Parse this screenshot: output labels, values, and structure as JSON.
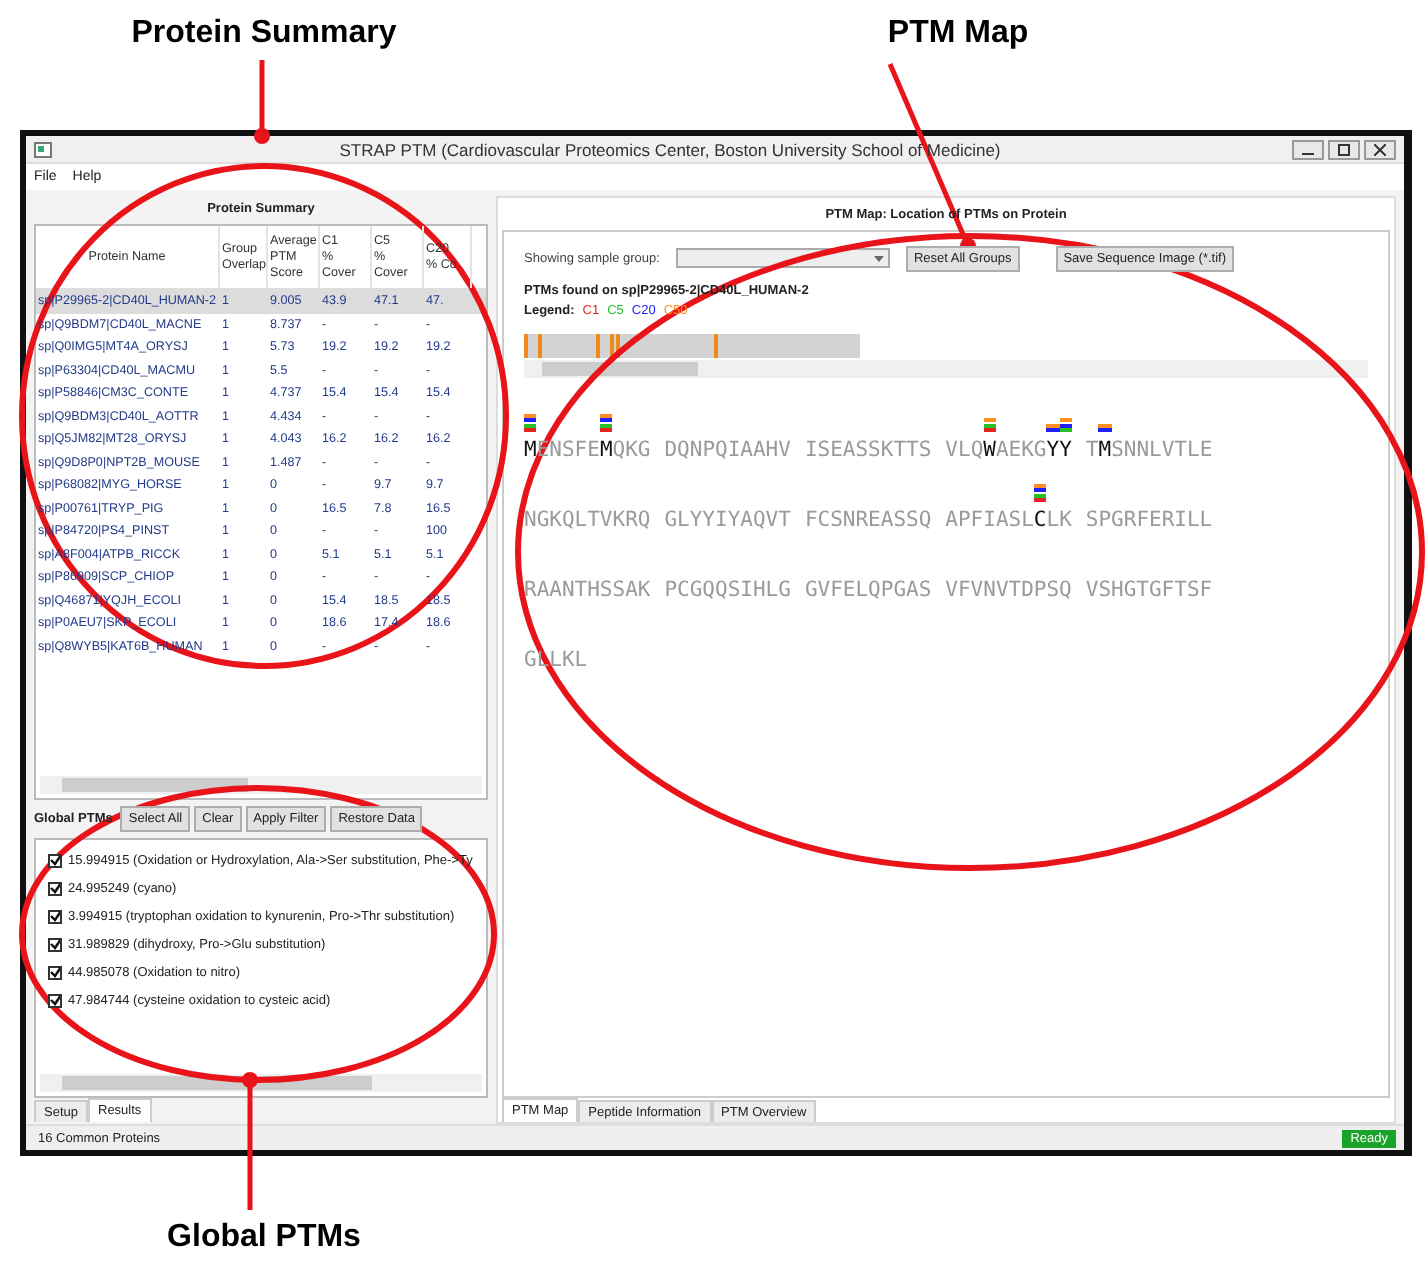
{
  "annotations": {
    "top_left": "Protein Summary",
    "top_right": "PTM Map",
    "bottom": "Global PTMs"
  },
  "window": {
    "title": "STRAP PTM (Cardiovascular Proteomics Center, Boston University School of Medicine)"
  },
  "menu": [
    "File",
    "Help"
  ],
  "protein_summary": {
    "heading": "Protein Summary",
    "columns": [
      "Protein Name",
      "Group\nOverlap",
      "Average\nPTM\nScore",
      "C1\n% Cover",
      "C5\n% Cover",
      "C20\n% Co"
    ],
    "rows": [
      {
        "selected": true,
        "cells": [
          "sp|P29965-2|CD40L_HUMAN-2",
          "1",
          "9.005",
          "43.9",
          "47.1",
          "47."
        ]
      },
      {
        "selected": false,
        "cells": [
          "sp|Q9BDM7|CD40L_MACNE",
          "1",
          "8.737",
          "-",
          "-",
          "-"
        ]
      },
      {
        "selected": false,
        "cells": [
          "sp|Q0IMG5|MT4A_ORYSJ",
          "1",
          "5.73",
          "19.2",
          "19.2",
          "19.2"
        ]
      },
      {
        "selected": false,
        "cells": [
          "sp|P63304|CD40L_MACMU",
          "1",
          "5.5",
          "-",
          "-",
          "-"
        ]
      },
      {
        "selected": false,
        "cells": [
          "sp|P58846|CM3C_CONTE",
          "1",
          "4.737",
          "15.4",
          "15.4",
          "15.4"
        ]
      },
      {
        "selected": false,
        "cells": [
          "sp|Q9BDM3|CD40L_AOTTR",
          "1",
          "4.434",
          "-",
          "-",
          "-"
        ]
      },
      {
        "selected": false,
        "cells": [
          "sp|Q5JM82|MT28_ORYSJ",
          "1",
          "4.043",
          "16.2",
          "16.2",
          "16.2"
        ]
      },
      {
        "selected": false,
        "cells": [
          "sp|Q9D8P0|NPT2B_MOUSE",
          "1",
          "1.487",
          "-",
          "-",
          "-"
        ]
      },
      {
        "selected": false,
        "cells": [
          "sp|P68082|MYG_HORSE",
          "1",
          "0",
          "-",
          "9.7",
          "9.7"
        ]
      },
      {
        "selected": false,
        "cells": [
          "sp|P00761|TRYP_PIG",
          "1",
          "0",
          "16.5",
          "7.8",
          "16.5"
        ]
      },
      {
        "selected": false,
        "cells": [
          "sp|P84720|PS4_PINST",
          "1",
          "0",
          "-",
          "-",
          "100"
        ]
      },
      {
        "selected": false,
        "cells": [
          "sp|A8F004|ATPB_RICCK",
          "1",
          "0",
          "5.1",
          "5.1",
          "5.1"
        ]
      },
      {
        "selected": false,
        "cells": [
          "sp|P86909|SCP_CHIOP",
          "1",
          "0",
          "-",
          "-",
          "-"
        ]
      },
      {
        "selected": false,
        "cells": [
          "sp|Q46871|YQJH_ECOLI",
          "1",
          "0",
          "15.4",
          "18.5",
          "18.5"
        ]
      },
      {
        "selected": false,
        "cells": [
          "sp|P0AEU7|SKP_ECOLI",
          "1",
          "0",
          "18.6",
          "17.4",
          "18.6"
        ]
      },
      {
        "selected": false,
        "cells": [
          "sp|Q8WYB5|KAT6B_HUMAN",
          "1",
          "0",
          "-",
          "-",
          "-"
        ]
      }
    ]
  },
  "global_ptms": {
    "label": "Global PTMs",
    "buttons": [
      "Select All",
      "Clear",
      "Apply Filter",
      "Restore Data"
    ],
    "items": [
      {
        "checked": true,
        "text": "15.994915 (Oxidation or Hydroxylation, Ala->Ser substitution, Phe->Ty"
      },
      {
        "checked": true,
        "text": "24.995249 (cyano)"
      },
      {
        "checked": true,
        "text": "3.994915 (tryptophan oxidation to kynurenin, Pro->Thr substitution)"
      },
      {
        "checked": true,
        "text": "31.989829 (dihydroxy, Pro->Glu substitution)"
      },
      {
        "checked": true,
        "text": "44.985078 (Oxidation to nitro)"
      },
      {
        "checked": true,
        "text": "47.984744 (cysteine oxidation to cysteic acid)"
      }
    ]
  },
  "left_tabs": [
    {
      "label": "Setup",
      "selected": false
    },
    {
      "label": "Results",
      "selected": true
    }
  ],
  "ptm_map": {
    "heading": "PTM Map: Location of PTMs on Protein",
    "group_label": "Showing sample group:",
    "buttons": [
      "Reset All Groups",
      "Save Sequence Image (*.tif)"
    ],
    "found": "PTMs found on sp|P29965-2|CD40L_HUMAN-2",
    "legend_label": "Legend:",
    "legend": [
      {
        "label": "C1",
        "color": "#e82020"
      },
      {
        "label": "C5",
        "color": "#28c028"
      },
      {
        "label": "C20",
        "color": "#2020ff"
      },
      {
        "label": "C50",
        "color": "#ff9020"
      }
    ],
    "sequence": [
      [
        [
          {
            "text": "M",
            "marks": [
              {
                "color": "#ff9020"
              },
              {
                "color": "#2020ff"
              },
              {
                "color": "#28c028"
              },
              {
                "color": "#e82020"
              }
            ]
          },
          {
            "text": "ENSFE"
          },
          {
            "text": "M",
            "marks": [
              {
                "color": "#ff9020"
              },
              {
                "color": "#2020ff"
              },
              {
                "color": "#28c028"
              },
              {
                "color": "#e82020"
              }
            ]
          },
          {
            "text": "QKG"
          }
        ],
        [
          {
            "text": "DQNPQIAAHV"
          }
        ],
        [
          {
            "text": "ISEASSKTTS"
          }
        ],
        [
          {
            "text": "VLQ"
          },
          {
            "text": "W",
            "marks": [
              {
                "color": "#ff9020"
              },
              {
                "color": "#28c028"
              },
              {
                "color": "#e82020"
              }
            ]
          },
          {
            "text": "AEKG"
          },
          {
            "text": "Y",
            "marks": [
              {
                "color": "#ff9020"
              },
              {
                "color": "#2020ff"
              }
            ]
          },
          {
            "text": "Y",
            "marks": [
              {
                "color": "#ff9020"
              },
              {
                "color": "#2020ff"
              },
              {
                "color": "#28c028"
              }
            ]
          }
        ],
        [
          {
            "text": "T"
          },
          {
            "text": "M",
            "marks": [
              {
                "color": "#ff9020"
              },
              {
                "color": "#2020ff"
              }
            ]
          },
          {
            "text": "SNNLVTLE"
          }
        ]
      ],
      [
        [
          {
            "text": "NGKQLTVKRQ"
          }
        ],
        [
          {
            "text": "GLYYIYAQVT"
          }
        ],
        [
          {
            "text": "FCSNREASSQ"
          }
        ],
        [
          {
            "text": "APFIASL"
          },
          {
            "text": "C",
            "marks": [
              {
                "color": "#ff9020"
              },
              {
                "color": "#2020ff"
              },
              {
                "color": "#28c028"
              },
              {
                "color": "#e82020"
              }
            ]
          },
          {
            "text": "LK"
          }
        ],
        [
          {
            "text": "SPGRFERILL"
          }
        ]
      ],
      [
        [
          {
            "text": "RAANTHSSAK"
          }
        ],
        [
          {
            "text": "PCGQQSIHLG"
          }
        ],
        [
          {
            "text": "GVFELQPGAS"
          }
        ],
        [
          {
            "text": "VFVNVTDPSQ"
          }
        ],
        [
          {
            "text": "VSHGTGFTSF"
          }
        ]
      ],
      [
        [
          {
            "text": "GLLKL"
          }
        ]
      ]
    ]
  },
  "right_tabs": [
    {
      "label": "PTM Map",
      "selected": true
    },
    {
      "label": "Peptide Information",
      "selected": false
    },
    {
      "label": "PTM Overview",
      "selected": false
    }
  ],
  "status": {
    "left": "16 Common Proteins",
    "right": "Ready"
  }
}
